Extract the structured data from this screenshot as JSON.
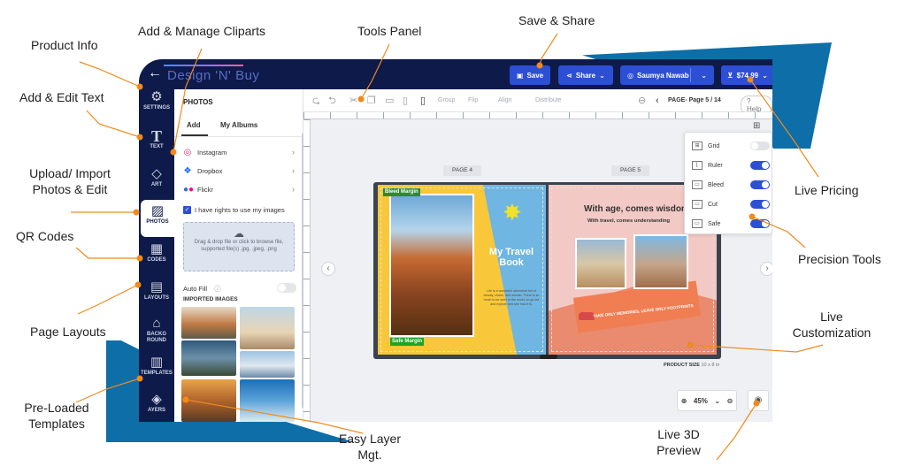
{
  "annotations": {
    "product_info": "Product Info",
    "add_manage_cliparts": "Add & Manage Cliparts",
    "tools_panel": "Tools Panel",
    "save_share": "Save & Share",
    "add_edit_text": "Add & Edit Text",
    "upload_import_l1": "Upload/ Import",
    "upload_import_l2": "Photos & Edit",
    "live_pricing": "Live Pricing",
    "qr_codes": "QR Codes",
    "precision_tools": "Precision Tools",
    "page_layouts": "Page Layouts",
    "live_customization_l1": "Live",
    "live_customization_l2": "Customization",
    "preloaded_l1": "Pre-Loaded",
    "preloaded_l2": "Templates",
    "easy_layer_l1": "Easy Layer",
    "easy_layer_l2": "Mgt.",
    "live_3d_l1": "Live 3D",
    "live_3d_l2": "Preview"
  },
  "topbar": {
    "logo": "Design 'N' Buy",
    "save_label": "Save",
    "share_label": "Share",
    "user_name": "Saumya Nawab",
    "price": "$74.99"
  },
  "rail": {
    "items": [
      {
        "label": "SETTINGS",
        "icon": "gear-icon"
      },
      {
        "label": "TEXT",
        "icon": "text-icon"
      },
      {
        "label": "ART",
        "icon": "art-icon"
      },
      {
        "label": "PHOTOS",
        "icon": "photo-icon"
      },
      {
        "label": "CODES",
        "icon": "qr-icon"
      },
      {
        "label": "LAYOUTS",
        "icon": "layout-icon"
      },
      {
        "label": "BACKGROUND",
        "icon": "background-icon"
      },
      {
        "label": "TEMPLATES",
        "icon": "template-icon"
      },
      {
        "label": "AYERS",
        "icon": "layers-icon"
      }
    ]
  },
  "panel": {
    "title": "PHOTOS",
    "tab_add": "Add",
    "tab_albums": "My Albums",
    "sources": [
      "Instagram",
      "Dropbox",
      "Flickr"
    ],
    "rights_label": "I have rights to use my images",
    "drop_line1": "Drag & drop file or click to browse file,",
    "drop_line2": "supported file(s) .jpg, .jpeg, .png",
    "autofill_label": "Auto Fill",
    "imported_label": "IMPORTED IMAGES"
  },
  "toolsbar": {
    "group": "Group",
    "flip": "Flip",
    "align": "Align",
    "distribute": "Distribute",
    "page_indicator": "PAGE- Page 5 / 14",
    "help": "Help"
  },
  "canvas": {
    "page_left_label": "PAGE 4",
    "page_right_label": "PAGE 5",
    "bleed_margin": "Bleed Margin",
    "safe_margin": "Safe Margin",
    "book_title_l1": "My Travel",
    "book_title_l2": "Book",
    "book_body": "Life is a wonderful adventure full of beauty, charm, and wonder. There is so much to be seen in the world, so go out and explore and see how it is.",
    "right_headline": "With age, comes wisdom",
    "right_subline": "With travel, comes understanding",
    "right_banner": "TAKE ONLY MEMORIES, LEAVE ONLY FOOTPRINTS",
    "product_size_label": "PRODUCT SIZE",
    "product_size_value": "10 x 8 in"
  },
  "precision": {
    "items": [
      {
        "label": "Grid",
        "on": false
      },
      {
        "label": "Ruler",
        "on": true
      },
      {
        "label": "Bleed",
        "on": true
      },
      {
        "label": "Cut",
        "on": true
      },
      {
        "label": "Safe",
        "on": true
      }
    ]
  },
  "zoom": {
    "level": "45%"
  },
  "colors": {
    "navy": "#0e1a49",
    "accent_blue": "#2c4fd4",
    "orange": "#f08a1c",
    "deco_blue": "#0d6ea8"
  }
}
